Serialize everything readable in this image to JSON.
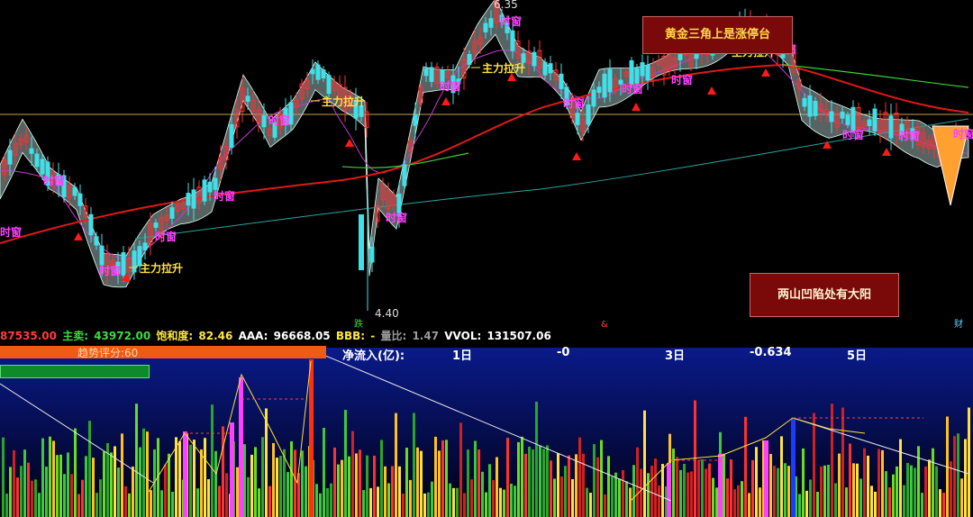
{
  "price_labels": {
    "high": "6.35",
    "low": "4.40"
  },
  "annotations": {
    "signal_timing": "时窗",
    "main_force": "主力拉升",
    "box1": "黄金三角上是涨停台",
    "box2": "两山凹陷处有大阳"
  },
  "axis_markers": {
    "fall": "跌",
    "mid": "&",
    "fiscal": "财"
  },
  "status": {
    "buy_value": "87535.00",
    "sell_label": "主卖:",
    "sell_value": "43972.00",
    "sat_label": "饱和度:",
    "sat_value": "82.46",
    "aaa_label": "AAA:",
    "aaa_value": "96668.05",
    "bbb_label": "BBB:",
    "bbb_value": "-",
    "vol_ratio_label": "量比:",
    "vol_ratio_value": "1.47",
    "vvol_label": "VVOL:",
    "vvol_value": "131507.06"
  },
  "flow": {
    "label": "净流入(亿):",
    "d1_label": "1日",
    "d1_value": "-0",
    "d3_label": "3日",
    "d3_value": "-0.634",
    "d5_label": "5日"
  },
  "score": {
    "label": "趋势评分:60"
  },
  "colors": {
    "up": "#ff3030",
    "down": "#40e0e8",
    "ma_red": "#e01818",
    "ma_teal": "#2aa5a0",
    "ma_green": "#3ad23a",
    "ma_purple": "#c03cd0",
    "band": "#9fb4b4",
    "signal": "#ff40ff",
    "arrow": "#ff1a1a"
  }
}
